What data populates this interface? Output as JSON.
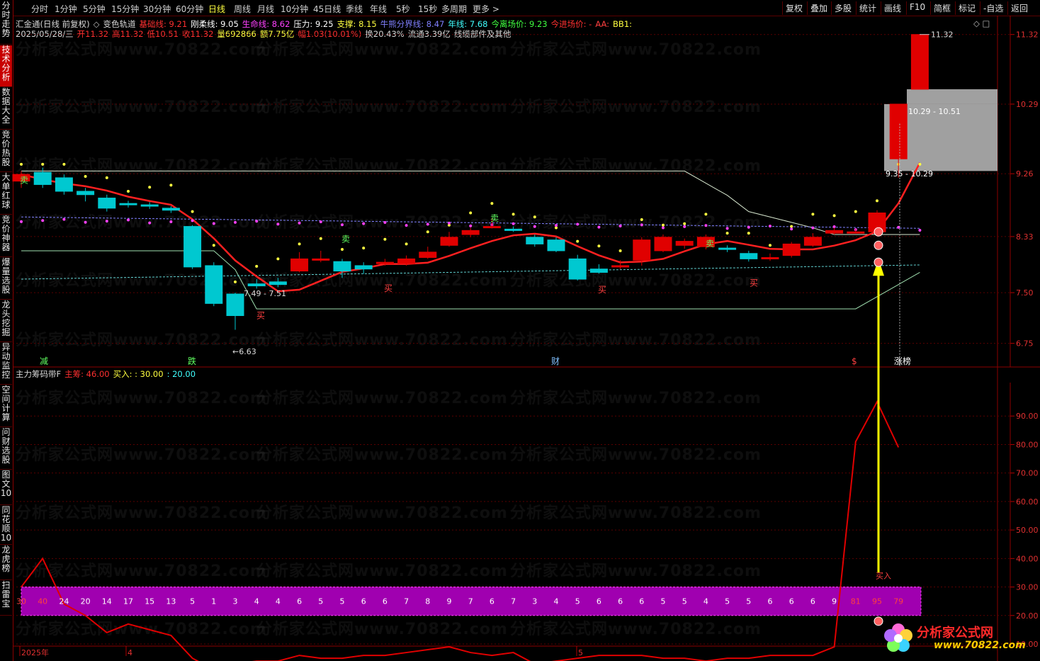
{
  "topbar": {
    "periods": [
      "分时",
      "1分钟",
      "5分钟",
      "15分钟",
      "30分钟",
      "60分钟",
      "日线",
      "周线",
      "月线",
      "10分钟",
      "45日线",
      "季线",
      "年线",
      "5秒",
      "15秒",
      "多周期",
      "更多 >"
    ],
    "active_period": "日线",
    "tools": [
      "复权",
      "叠加",
      "多股",
      "统计",
      "画线",
      "F10",
      "简框",
      "标记",
      "-自选",
      "返回"
    ]
  },
  "sidebar": [
    "分时走势",
    "技术分析",
    "数据大全",
    "竞价热股",
    "大单红球",
    "竞价神器",
    "爆量选股",
    "龙头挖掘",
    "异动监控",
    "空间计算",
    "问财选股",
    "图文10",
    "同花顺10",
    "龙虎榜",
    "扫雷宝"
  ],
  "sidebar_active": "技术分析",
  "main_info": {
    "line1": [
      {
        "t": "汇金通(日线 前复权)",
        "c": "#d8d8d8"
      },
      {
        "t": "◇",
        "c": "#bbbbbb"
      },
      {
        "t": "变色轨道",
        "c": "#d8d8d8"
      },
      {
        "t": "基础线: 9.21",
        "c": "#ff3030"
      },
      {
        "t": "刚柔线: 9.05",
        "c": "#ffffff"
      },
      {
        "t": "生命线: 8.62",
        "c": "#ff40ff"
      },
      {
        "t": "压力: 9.25",
        "c": "#ffffff"
      },
      {
        "t": "支撑: 8.15",
        "c": "#ffff40"
      },
      {
        "t": "牛熊分界线: 8.47",
        "c": "#8080ff"
      },
      {
        "t": "年线: 7.68",
        "c": "#40ffff"
      },
      {
        "t": "今离场价: 9.23",
        "c": "#40ff40"
      },
      {
        "t": "今进场价: -",
        "c": "#ff3030"
      },
      {
        "t": "AA:",
        "c": "#ff4040"
      },
      {
        "t": "BB1:",
        "c": "#ffff40"
      }
    ],
    "line2": [
      {
        "t": "2025/05/28/三",
        "c": "#d8d8d8"
      },
      {
        "t": "开11.32",
        "c": "#ff3030"
      },
      {
        "t": "高11.32",
        "c": "#ff3030"
      },
      {
        "t": "低10.51",
        "c": "#ff3030"
      },
      {
        "t": "收11.32",
        "c": "#ff3030"
      },
      {
        "t": "量692866",
        "c": "#ffff40"
      },
      {
        "t": "额7.75亿",
        "c": "#ffff40"
      },
      {
        "t": "幅1.03(10.01%)",
        "c": "#ff3030"
      },
      {
        "t": "换20.43%",
        "c": "#d8d8d8"
      },
      {
        "t": "流通3.39亿",
        "c": "#d8d8d8"
      },
      {
        "t": "线缆部件及其他",
        "c": "#d8d8d8"
      }
    ],
    "corner_icons": "◇ □"
  },
  "sub_info": {
    "line": [
      {
        "t": "主力筹码带F",
        "c": "#d8d8d8"
      },
      {
        "t": "主筹: 46.00",
        "c": "#ff3030"
      },
      {
        "t": "买入: : 30.00",
        "c": "#ffff40"
      },
      {
        "t": ": 20.00",
        "c": "#40ffff"
      }
    ]
  },
  "main_axis_ticks": [
    "11.32",
    "10.29",
    "9.26",
    "8.33",
    "7.50",
    "6.75"
  ],
  "sub_axis_ticks": [
    "90.00",
    "80.00",
    "70.00",
    "60.00",
    "50.00",
    "40.00",
    "30.00",
    "20.00",
    "10.00"
  ],
  "date_axis": [
    "2025年",
    "4",
    "5"
  ],
  "annotations": {
    "high_label": "11.32",
    "low_label": "6.63",
    "range1": "7.49 - 7.51",
    "range2": "10.29 - 10.51",
    "range3": "9.35 - 10.29",
    "bottom_marks": [
      "减",
      "跌",
      "财",
      "$",
      "涨榜"
    ],
    "sell_mark": "卖",
    "buy_mark": "买",
    "buy_sub_mark": "买入"
  },
  "band_values": [
    "30",
    "40",
    "24",
    "20",
    "14",
    "17",
    "15",
    "13",
    "5",
    "1",
    "3",
    "4",
    "4",
    "6",
    "5",
    "5",
    "6",
    "6",
    "7",
    "8",
    "9",
    "7",
    "6",
    "7",
    "3",
    "4",
    "5",
    "6",
    "6",
    "6",
    "5",
    "5",
    "4",
    "5",
    "5",
    "6",
    "6",
    "6",
    "9",
    "81",
    "95",
    "79"
  ],
  "watermark": "分析家公式网www.70822.com",
  "logo": {
    "name": "分析家公式网",
    "url": "www.70822.com"
  },
  "colors": {
    "up": "#e00000",
    "down": "#00c8d0",
    "ma": "#ff2020",
    "arrow": "#ffff00",
    "band": "#a000b0"
  },
  "chart_data": {
    "type": "candlestick",
    "candles": [
      [
        9.15,
        9.25,
        9.3,
        9.05
      ],
      [
        9.28,
        9.1,
        9.35,
        9.05
      ],
      [
        9.2,
        9.0,
        9.25,
        8.95
      ],
      [
        9.0,
        8.95,
        9.05,
        8.85
      ],
      [
        8.9,
        8.75,
        8.95,
        8.7
      ],
      [
        8.82,
        8.8,
        8.86,
        8.76
      ],
      [
        8.8,
        8.78,
        8.84,
        8.74
      ],
      [
        8.75,
        8.72,
        8.78,
        8.68
      ],
      [
        8.48,
        7.88,
        8.5,
        7.85
      ],
      [
        7.9,
        7.34,
        7.95,
        7.3
      ],
      [
        7.48,
        7.16,
        7.5,
        6.95
      ],
      [
        7.63,
        7.6,
        7.7,
        7.56
      ],
      [
        7.66,
        7.62,
        7.72,
        7.58
      ],
      [
        7.82,
        8.0,
        8.1,
        7.8
      ],
      [
        7.99,
        8.0,
        8.12,
        7.95
      ],
      [
        7.96,
        7.82,
        8.0,
        7.72
      ],
      [
        7.9,
        7.85,
        7.95,
        7.78
      ],
      [
        7.93,
        7.95,
        8.0,
        7.9
      ],
      [
        7.93,
        8.0,
        8.05,
        7.9
      ],
      [
        8.02,
        8.1,
        8.18,
        8.0
      ],
      [
        8.2,
        8.32,
        8.4,
        8.18
      ],
      [
        8.36,
        8.42,
        8.46,
        8.32
      ],
      [
        8.47,
        8.48,
        8.6,
        8.45
      ],
      [
        8.44,
        8.42,
        8.48,
        8.4
      ],
      [
        8.32,
        8.22,
        8.36,
        8.18
      ],
      [
        8.28,
        8.12,
        8.32,
        8.1
      ],
      [
        8.0,
        7.7,
        8.06,
        7.68
      ],
      [
        7.85,
        7.8,
        7.92,
        7.78
      ],
      [
        7.88,
        7.9,
        7.98,
        7.85
      ],
      [
        7.98,
        8.28,
        8.32,
        7.9
      ],
      [
        8.12,
        8.32,
        8.36,
        8.1
      ],
      [
        8.2,
        8.26,
        8.3,
        8.15
      ],
      [
        8.18,
        8.32,
        8.36,
        8.14
      ],
      [
        8.16,
        8.14,
        8.2,
        8.1
      ],
      [
        8.08,
        8.0,
        8.12,
        7.96
      ],
      [
        8.02,
        8.02,
        8.08,
        7.97
      ],
      [
        8.05,
        8.22,
        8.25,
        8.02
      ],
      [
        8.2,
        8.32,
        8.38,
        8.18
      ],
      [
        8.38,
        8.42,
        8.46,
        8.36
      ],
      [
        8.4,
        8.4,
        8.44,
        8.38
      ],
      [
        8.4,
        8.68,
        8.72,
        8.36
      ],
      [
        9.48,
        10.29,
        10.29,
        9.2
      ],
      [
        10.51,
        11.32,
        11.32,
        10.51
      ]
    ],
    "sub_line": [
      30,
      40,
      24,
      20,
      14,
      17,
      15,
      13,
      5,
      1,
      3,
      4,
      4,
      6,
      5,
      5,
      6,
      6,
      7,
      8,
      9,
      7,
      6,
      7,
      3,
      4,
      5,
      6,
      6,
      6,
      5,
      5,
      4,
      5,
      5,
      6,
      6,
      6,
      9,
      81,
      95,
      79
    ],
    "ylim_main": [
      6.4,
      11.6
    ],
    "ylim_sub": [
      10,
      100
    ]
  }
}
